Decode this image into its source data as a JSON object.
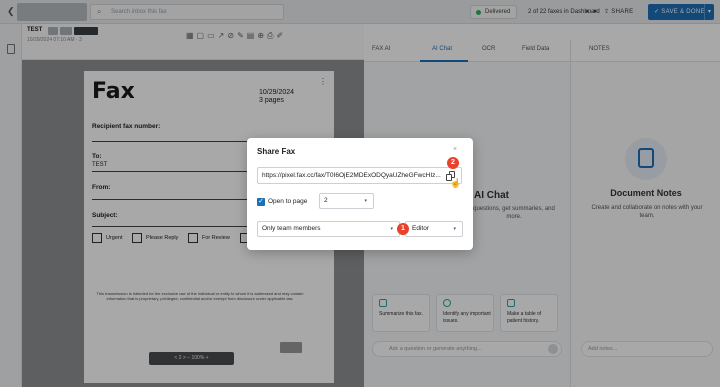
{
  "topbar": {
    "search_placeholder": "Search inbox this fax",
    "status": "Delivered",
    "pager": "2 of 22 faxes in Dashboard",
    "share_label": "SHARE",
    "save_label": "SAVE & DONE"
  },
  "document": {
    "name": "TEST",
    "subtitle": "10/29/2024 07:10 AM · 3",
    "fax_title": "Fax",
    "date": "10/29/2024",
    "pages": "3 pages",
    "recipient_label": "Recipient fax number:",
    "to_label": "To:",
    "to_value": "TEST",
    "from_label": "From:",
    "subject_label": "Subject:",
    "checkboxes": [
      "Urgent",
      "Please Reply",
      "For Review"
    ],
    "disclaimer": "This transmission is intended for the exclusive use of the individual or entity to whom it is addressed and may contain information that is proprietary, privileged, confidential and/or exempt from disclosure under applicable law.",
    "zoom": "< 2 >   −  100%  +"
  },
  "ai_panel": {
    "tabs": [
      "FAX AI",
      "AI Chat",
      "OCR",
      "Field Data"
    ],
    "title": "AI Chat",
    "description": "questions, get summaries, and more.",
    "suggestions": [
      "Summarize this fax.",
      "Identify any important issues.",
      "Make a table of patient history."
    ],
    "ask_placeholder": "Ask a question or generate anything..."
  },
  "notes_panel": {
    "header": "NOTES",
    "title": "Document Notes",
    "description": "Create and collaborate on notes with your team.",
    "add_placeholder": "Add notes..."
  },
  "modal": {
    "title": "Share Fax",
    "close": "×",
    "url": "https://pixel.fax.cc/fax/T0I6OjE2MDExODQyaUZheGFwcHIz...",
    "open_to_page_label": "Open to page",
    "page_value": "2",
    "access_value": "Only team members",
    "role_value": "Editor",
    "markers": [
      "1",
      "2"
    ]
  },
  "colors": {
    "accent": "#1d6fb6",
    "marker": "#e8412c",
    "delivered": "#2fb157"
  }
}
